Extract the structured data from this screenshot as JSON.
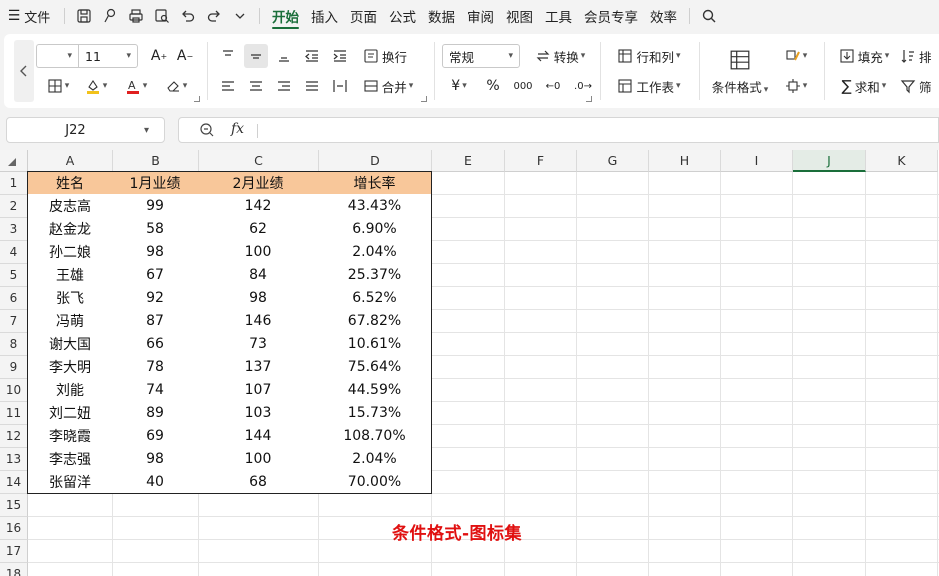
{
  "menu": {
    "file_label": "文件",
    "tabs": [
      "开始",
      "插入",
      "页面",
      "公式",
      "数据",
      "审阅",
      "视图",
      "工具",
      "会员专享",
      "效率"
    ]
  },
  "ribbon": {
    "font_size": "11",
    "wrap_label": "换行",
    "merge_label": "合并",
    "number_format": "常规",
    "convert_label": "转换",
    "rowcol_label": "行和列",
    "sheet_label": "工作表",
    "cond_format_label": "条件格式",
    "fill_label": "填充",
    "sort_label": "排",
    "sum_label": "求和",
    "filter_label": "筛",
    "currency_symbol": "¥",
    "percent_symbol": "%",
    "thousands_symbol": "000"
  },
  "formula_bar": {
    "name_box": "J22",
    "fx_label": "fx"
  },
  "columns": [
    "A",
    "B",
    "C",
    "D",
    "E",
    "F",
    "G",
    "H",
    "I",
    "J",
    "K"
  ],
  "active_column": "J",
  "rows": [
    "1",
    "2",
    "3",
    "4",
    "5",
    "6",
    "7",
    "8",
    "9",
    "10",
    "11",
    "12",
    "13",
    "14",
    "15",
    "16",
    "17",
    "18"
  ],
  "table": {
    "headers": [
      "姓名",
      "1月业绩",
      "2月业绩",
      "增长率"
    ],
    "rows": [
      [
        "皮志高",
        "99",
        "142",
        "43.43%"
      ],
      [
        "赵金龙",
        "58",
        "62",
        "6.90%"
      ],
      [
        "孙二娘",
        "98",
        "100",
        "2.04%"
      ],
      [
        "王雄",
        "67",
        "84",
        "25.37%"
      ],
      [
        "张飞",
        "92",
        "98",
        "6.52%"
      ],
      [
        "冯萌",
        "87",
        "146",
        "67.82%"
      ],
      [
        "谢大国",
        "66",
        "73",
        "10.61%"
      ],
      [
        "李大明",
        "78",
        "137",
        "75.64%"
      ],
      [
        "刘能",
        "74",
        "107",
        "44.59%"
      ],
      [
        "刘二妞",
        "89",
        "103",
        "15.73%"
      ],
      [
        "李晓霞",
        "69",
        "144",
        "108.70%"
      ],
      [
        "李志强",
        "98",
        "100",
        "2.04%"
      ],
      [
        "张留洋",
        "40",
        "68",
        "70.00%"
      ]
    ]
  },
  "caption": "条件格式-图标集",
  "colors": {
    "header_fill": "#f8c79a",
    "caption": "#e01010",
    "accent": "#1a6e3a"
  }
}
